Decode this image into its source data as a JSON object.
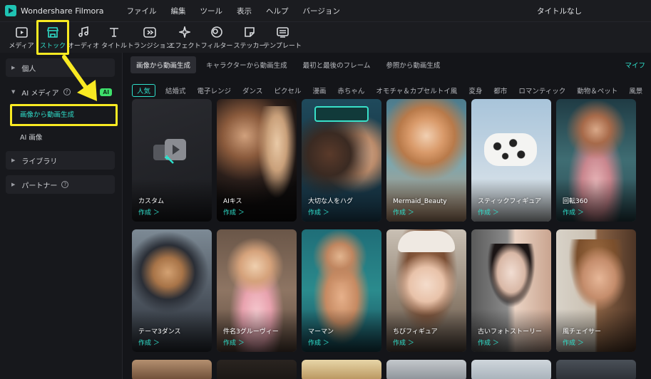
{
  "app": {
    "name": "Wondershare Filmora",
    "document_title": "タイトルなし"
  },
  "menu": [
    "ファイル",
    "編集",
    "ツール",
    "表示",
    "ヘルプ",
    "バージョン"
  ],
  "toolbar": [
    {
      "label": "メディア",
      "icon": "media-icon"
    },
    {
      "label": "ストック",
      "icon": "store-icon",
      "active": true
    },
    {
      "label": "オーディオ",
      "icon": "music-note-icon"
    },
    {
      "label": "タイトル",
      "icon": "title-t-icon"
    },
    {
      "label": "トランジション",
      "icon": "transition-icon"
    },
    {
      "label": "エフェクト",
      "icon": "effect-sparkle-icon"
    },
    {
      "label": "フィルター",
      "icon": "filter-icon"
    },
    {
      "label": "ステッカー",
      "icon": "sticker-icon"
    },
    {
      "label": "テンプレート",
      "icon": "template-icon"
    }
  ],
  "sidebar": {
    "personal": "個人",
    "ai_media": "AI メディア",
    "ai_badge": "AI",
    "ai_items": [
      "画像から動画生成",
      "AI 画像"
    ],
    "library": "ライブラリ",
    "partner": "パートナー"
  },
  "sub_tabs": [
    "画像から動画生成",
    "キャラクターから動画生成",
    "最初と最後のフレーム",
    "参照から動画生成"
  ],
  "sub_tab_more": "マイフ",
  "categories": [
    "人気",
    "結婚式",
    "電子レンジ",
    "ダンス",
    "ピクセル",
    "漫画",
    "赤ちゃん",
    "オモチャ＆カプセルトイ風",
    "変身",
    "都市",
    "ロマンティック",
    "動物＆ペット",
    "風景"
  ],
  "cards": [
    {
      "name": "カスタム",
      "action": "作成 ＞"
    },
    {
      "name": "AIキス",
      "action": "作成 ＞"
    },
    {
      "name": "大切な人をハグ",
      "action": "作成 ＞"
    },
    {
      "name": "Mermaid_Beauty",
      "action": "作成 ＞"
    },
    {
      "name": "スティックフィギュア",
      "action": "作成 ＞"
    },
    {
      "name": "回転360",
      "action": "作成 ＞"
    },
    {
      "name": "テーマ3ダンス",
      "action": "作成 ＞"
    },
    {
      "name": "件名3グルーヴィー",
      "action": "作成 ＞"
    },
    {
      "name": "マーマン",
      "action": "作成 ＞"
    },
    {
      "name": "ちびフィギュア",
      "action": "作成 ＞"
    },
    {
      "name": "古いフォトストーリー",
      "action": "作成 ＞"
    },
    {
      "name": "風チェイサー",
      "action": "作成 ＞"
    }
  ],
  "colors": {
    "accent": "#2fe0cc",
    "highlight": "#f9ea22",
    "ai_badge": "#3ee06b"
  }
}
